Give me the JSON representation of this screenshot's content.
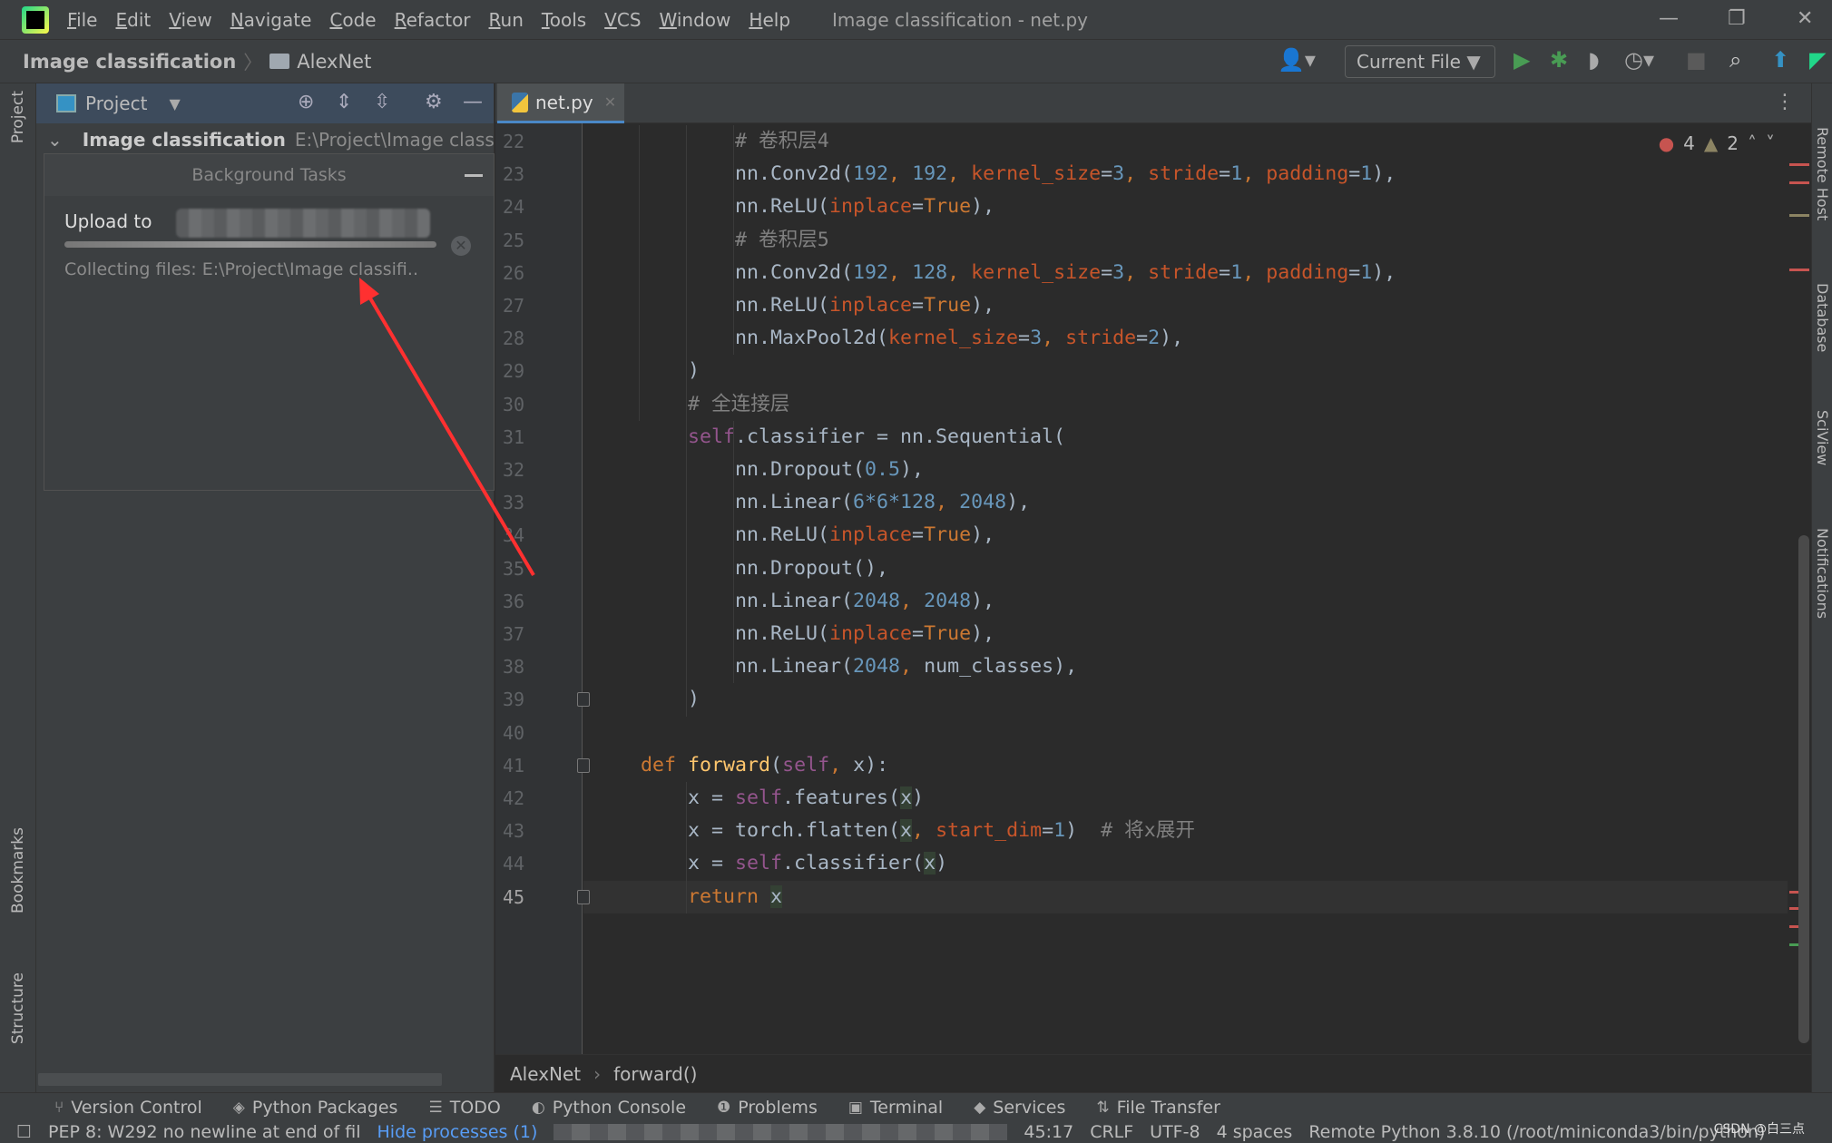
{
  "menubar": {
    "items": [
      "File",
      "Edit",
      "View",
      "Navigate",
      "Code",
      "Refactor",
      "Run",
      "Tools",
      "VCS",
      "Window",
      "Help"
    ],
    "title": "Image classification - net.py"
  },
  "navbar": {
    "project": "Image classification",
    "folder": "AlexNet",
    "run_config": "Current File"
  },
  "project_panel": {
    "title": "Project",
    "root_name": "Image classification",
    "root_path": "E:\\Project\\Image classifi"
  },
  "background_tasks": {
    "title": "Background Tasks",
    "task_label": "Upload to",
    "progress_percent": 100,
    "status": "Collecting files: E:\\Project\\Image classifi.."
  },
  "editor": {
    "tab": "net.py",
    "inspections": {
      "errors": "4",
      "warnings": "2"
    },
    "first_line": 22,
    "current_line": 45,
    "lines": [
      {
        "indent": 12,
        "tokens": [
          [
            "cm",
            "# 卷积层4"
          ]
        ]
      },
      {
        "indent": 12,
        "tokens": [
          [
            "",
            "nn.Conv2d("
          ],
          [
            "num",
            "192"
          ],
          [
            "kw",
            ", "
          ],
          [
            "num",
            "192"
          ],
          [
            "kw",
            ", "
          ],
          [
            "kwarg",
            "kernel_size"
          ],
          [
            "",
            "="
          ],
          [
            "num",
            "3"
          ],
          [
            "kw",
            ", "
          ],
          [
            "kwarg",
            "stride"
          ],
          [
            "",
            "="
          ],
          [
            "num",
            "1"
          ],
          [
            "kw",
            ", "
          ],
          [
            "kwarg",
            "padding"
          ],
          [
            "",
            "="
          ],
          [
            "num",
            "1"
          ],
          [
            "",
            "),"
          ]
        ]
      },
      {
        "indent": 12,
        "tokens": [
          [
            "",
            "nn.ReLU("
          ],
          [
            "kwarg",
            "inplace"
          ],
          [
            "",
            "="
          ],
          [
            "kw",
            "True"
          ],
          [
            "",
            "),"
          ]
        ]
      },
      {
        "indent": 12,
        "tokens": [
          [
            "cm",
            "# 卷积层5"
          ]
        ]
      },
      {
        "indent": 12,
        "tokens": [
          [
            "",
            "nn.Conv2d("
          ],
          [
            "num",
            "192"
          ],
          [
            "kw",
            ", "
          ],
          [
            "num",
            "128"
          ],
          [
            "kw",
            ", "
          ],
          [
            "kwarg",
            "kernel_size"
          ],
          [
            "",
            "="
          ],
          [
            "num",
            "3"
          ],
          [
            "kw",
            ", "
          ],
          [
            "kwarg",
            "stride"
          ],
          [
            "",
            "="
          ],
          [
            "num",
            "1"
          ],
          [
            "kw",
            ", "
          ],
          [
            "kwarg",
            "padding"
          ],
          [
            "",
            "="
          ],
          [
            "num",
            "1"
          ],
          [
            "",
            "),"
          ]
        ]
      },
      {
        "indent": 12,
        "tokens": [
          [
            "",
            "nn.ReLU("
          ],
          [
            "kwarg",
            "inplace"
          ],
          [
            "",
            "="
          ],
          [
            "kw",
            "True"
          ],
          [
            "",
            "),"
          ]
        ]
      },
      {
        "indent": 12,
        "tokens": [
          [
            "",
            "nn.MaxPool2d("
          ],
          [
            "kwarg",
            "kernel_size"
          ],
          [
            "",
            "="
          ],
          [
            "num",
            "3"
          ],
          [
            "kw",
            ", "
          ],
          [
            "kwarg",
            "stride"
          ],
          [
            "",
            "="
          ],
          [
            "num",
            "2"
          ],
          [
            "",
            "),"
          ]
        ]
      },
      {
        "indent": 8,
        "tokens": [
          [
            "",
            ")"
          ]
        ]
      },
      {
        "indent": 8,
        "tokens": [
          [
            "cm",
            "# 全连接层"
          ]
        ]
      },
      {
        "indent": 8,
        "tokens": [
          [
            "self",
            "self"
          ],
          [
            "",
            ".classifier = nn.Sequential("
          ]
        ]
      },
      {
        "indent": 12,
        "tokens": [
          [
            "",
            "nn.Dropout("
          ],
          [
            "num",
            "0.5"
          ],
          [
            "",
            "),"
          ]
        ]
      },
      {
        "indent": 12,
        "tokens": [
          [
            "",
            "nn.Linear("
          ],
          [
            "num",
            "6*6*128"
          ],
          [
            "kw",
            ", "
          ],
          [
            "num",
            "2048"
          ],
          [
            "",
            "),"
          ]
        ]
      },
      {
        "indent": 12,
        "tokens": [
          [
            "",
            "nn.ReLU("
          ],
          [
            "kwarg",
            "inplace"
          ],
          [
            "",
            "="
          ],
          [
            "kw",
            "True"
          ],
          [
            "",
            "),"
          ]
        ]
      },
      {
        "indent": 12,
        "tokens": [
          [
            "",
            "nn.Dropout(),"
          ]
        ]
      },
      {
        "indent": 12,
        "tokens": [
          [
            "",
            "nn.Linear("
          ],
          [
            "num",
            "2048"
          ],
          [
            "kw",
            ", "
          ],
          [
            "num",
            "2048"
          ],
          [
            "",
            "),"
          ]
        ]
      },
      {
        "indent": 12,
        "tokens": [
          [
            "",
            "nn.ReLU("
          ],
          [
            "kwarg",
            "inplace"
          ],
          [
            "",
            "="
          ],
          [
            "kw",
            "True"
          ],
          [
            "",
            "),"
          ]
        ]
      },
      {
        "indent": 12,
        "tokens": [
          [
            "",
            "nn.Linear("
          ],
          [
            "num",
            "2048"
          ],
          [
            "kw",
            ", "
          ],
          [
            "",
            "num_classes),"
          ]
        ]
      },
      {
        "indent": 8,
        "tokens": [
          [
            "",
            ")"
          ]
        ]
      },
      {
        "indent": 0,
        "tokens": []
      },
      {
        "indent": 4,
        "tokens": [
          [
            "kw",
            "def "
          ],
          [
            "fn",
            "forward"
          ],
          [
            "",
            "("
          ],
          [
            "self",
            "self"
          ],
          [
            "kw",
            ", "
          ],
          [
            "",
            "x):"
          ]
        ]
      },
      {
        "indent": 8,
        "tokens": [
          [
            "",
            "x = "
          ],
          [
            "self",
            "self"
          ],
          [
            "",
            ".features("
          ],
          [
            "x",
            "x"
          ],
          [
            "",
            ")"
          ]
        ]
      },
      {
        "indent": 8,
        "tokens": [
          [
            "",
            "x = torch.flatten("
          ],
          [
            "x",
            "x"
          ],
          [
            "kw",
            ", "
          ],
          [
            "kwarg",
            "start_dim"
          ],
          [
            "",
            "="
          ],
          [
            "num",
            "1"
          ],
          [
            "",
            ")  "
          ],
          [
            "cm",
            "# 将x展开"
          ]
        ]
      },
      {
        "indent": 8,
        "tokens": [
          [
            "",
            "x = "
          ],
          [
            "self",
            "self"
          ],
          [
            "",
            ".classifier("
          ],
          [
            "x",
            "x"
          ],
          [
            "",
            ")"
          ]
        ]
      },
      {
        "indent": 8,
        "tokens": [
          [
            "kw",
            "return "
          ],
          [
            "x",
            "x"
          ]
        ]
      }
    ]
  },
  "breadcrumb": [
    "AlexNet",
    "forward()"
  ],
  "right_strip": [
    "Remote Host",
    "Database",
    "SciView",
    "Notifications"
  ],
  "left_strip": [
    "Project",
    "Bookmarks",
    "Structure"
  ],
  "tool_windows": [
    {
      "icon": "version-control-icon",
      "glyph": "⑂",
      "label": "Version Control"
    },
    {
      "icon": "python-packages-icon",
      "glyph": "◈",
      "label": "Python Packages"
    },
    {
      "icon": "todo-icon",
      "glyph": "☰",
      "label": "TODO"
    },
    {
      "icon": "python-console-icon",
      "glyph": "◐",
      "label": "Python Console"
    },
    {
      "icon": "problems-icon",
      "glyph": "❶",
      "label": "Problems"
    },
    {
      "icon": "terminal-icon",
      "glyph": "▣",
      "label": "Terminal"
    },
    {
      "icon": "services-icon",
      "glyph": "◆",
      "label": "Services"
    },
    {
      "icon": "file-transfer-icon",
      "glyph": "⇅",
      "label": "File Transfer"
    }
  ],
  "status": {
    "message": "PEP 8: W292 no newline at end of fil",
    "hide_processes": "Hide processes (1)",
    "position": "45:17",
    "line_sep": "CRLF",
    "encoding": "UTF-8",
    "indent": "4 spaces",
    "interpreter": "Remote Python 3.8.10 (/root/miniconda3/bin/python)"
  },
  "watermark": "CSDN @白三点",
  "colors": {
    "accent": "#4a88c7",
    "annotation_arrow": "#ff3030",
    "error": "#c75450"
  }
}
